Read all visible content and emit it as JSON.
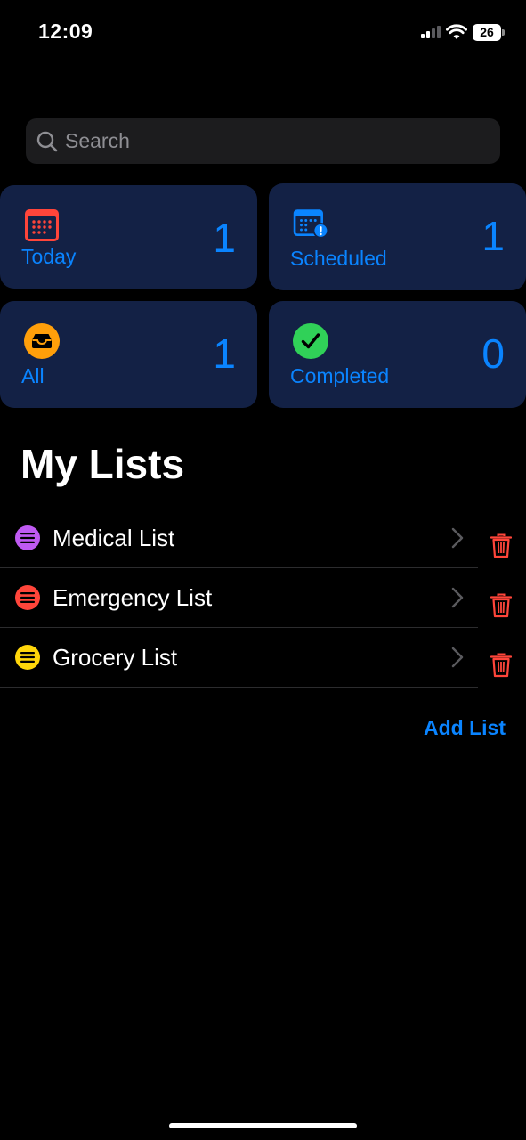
{
  "status_bar": {
    "time": "12:09",
    "battery_level": "26"
  },
  "search": {
    "placeholder": "Search",
    "value": ""
  },
  "smart_lists": [
    {
      "label": "Today",
      "count": "1",
      "icon": "calendar-icon",
      "color": "#ff453a"
    },
    {
      "label": "Scheduled",
      "count": "1",
      "icon": "calendar-clock-icon",
      "color": "#0a84ff"
    },
    {
      "label": "All",
      "count": "1",
      "icon": "tray-icon",
      "color": "#ff9f0a"
    },
    {
      "label": "Completed",
      "count": "0",
      "icon": "checkmark-icon",
      "color": "#30d158"
    }
  ],
  "my_lists": {
    "title": "My Lists",
    "items": [
      {
        "name": "Medical List",
        "color": "#bf5af2"
      },
      {
        "name": "Emergency List",
        "color": "#ff453a"
      },
      {
        "name": "Grocery List",
        "color": "#ffd60a"
      }
    ],
    "add_label": "Add List"
  },
  "colors": {
    "accent": "#0a84ff",
    "card_background": "#132145",
    "destructive": "#ff453a"
  }
}
